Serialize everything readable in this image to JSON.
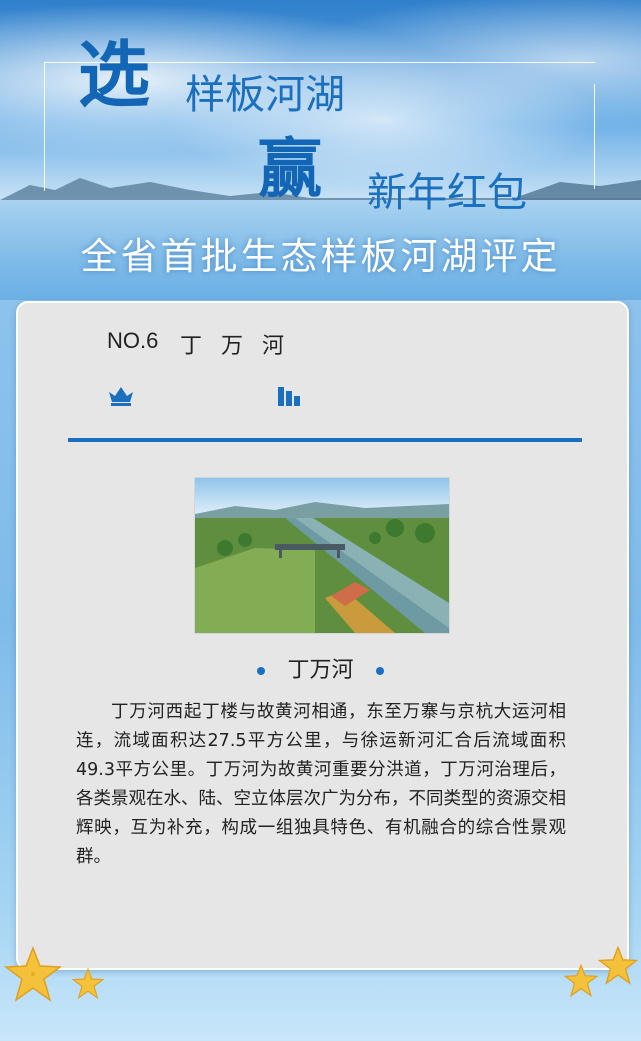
{
  "header": {
    "char_select": "选",
    "line1": "样板河湖",
    "char_win": "赢",
    "line2": "新年红包",
    "subtitle": "全省首批生态样板河湖评定"
  },
  "entry": {
    "number": "NO.6",
    "name": "丁 万 河",
    "caption": "丁万河",
    "description": "丁万河西起丁楼与故黄河相通，东至万寨与京杭大运河相连，流域面积达27.5平方公里，与徐运新河汇合后流域面积49.3平方公里。丁万河为故黄河重要分洪道，丁万河治理后，各类景观在水、陆、空立体层次广为分布，不同类型的资源交相辉映，互为补充，构成一组独具特色、有机融合的综合性景观群。"
  },
  "icons": {
    "crown": "crown-icon",
    "bars": "bar-chart-icon",
    "stars": "starfish-icon"
  },
  "colors": {
    "accent": "#1a6fbe",
    "title_blue": "#1266b5",
    "card_bg": "#e6e6e6"
  }
}
